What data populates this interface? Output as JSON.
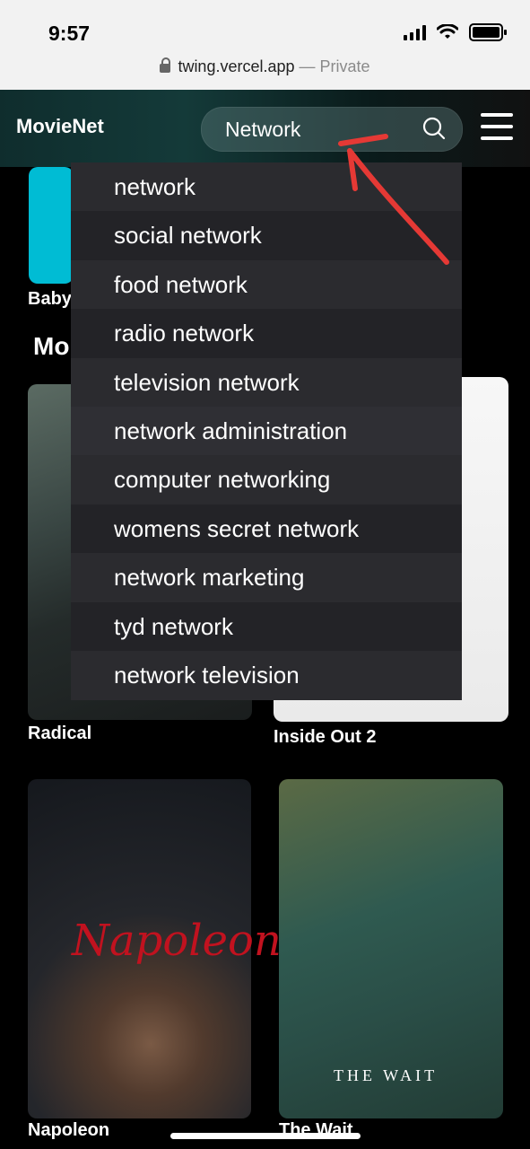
{
  "status_bar": {
    "time": "9:57"
  },
  "browser": {
    "url": "twing.vercel.app",
    "mode": "— Private"
  },
  "header": {
    "brand": "MovieNet",
    "search_value": "Network"
  },
  "dropdown": {
    "items": [
      "network",
      "social network",
      "food network",
      "radio network",
      "television network",
      "network administration",
      "computer networking",
      "womens secret network",
      "network marketing",
      "tyd network",
      "network television"
    ]
  },
  "content": {
    "partial_card_label": "Baby",
    "section_title_partial": "Mo",
    "cards": [
      {
        "title": "Radical"
      },
      {
        "title": "Inside Out 2"
      },
      {
        "title": "Napoleon",
        "poster_text": "Napoleon"
      },
      {
        "title": "The Wait",
        "poster_text": "THE WAIT"
      }
    ]
  },
  "colors": {
    "background": "#000000",
    "dropdown_bg": "#2b2b2f",
    "annotation_arrow": "#e53935"
  }
}
